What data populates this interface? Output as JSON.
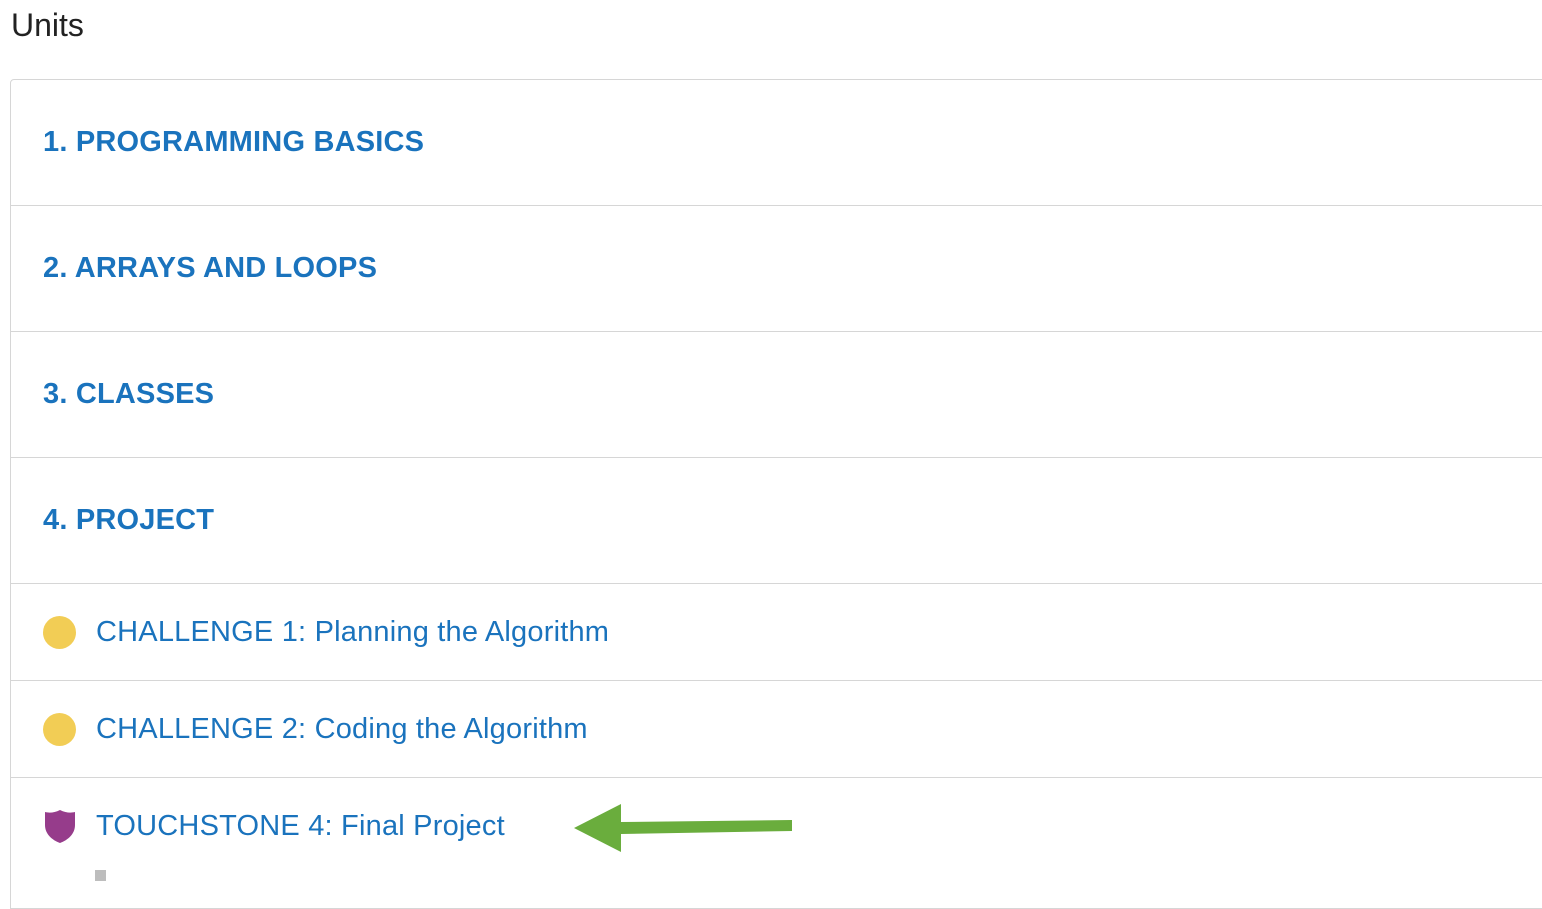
{
  "page": {
    "title": "Units"
  },
  "units": [
    {
      "label": "1. PROGRAMMING BASICS"
    },
    {
      "label": "2. ARRAYS AND LOOPS"
    },
    {
      "label": "3. CLASSES"
    },
    {
      "label": "4. PROJECT"
    }
  ],
  "activities": [
    {
      "label": "CHALLENGE 1: Planning the Algorithm",
      "icon": "circle-icon",
      "status_color": "#f2cd55"
    },
    {
      "label": "CHALLENGE 2: Coding the Algorithm",
      "icon": "circle-icon",
      "status_color": "#f2cd55"
    },
    {
      "label": "TOUCHSTONE 4: Final Project",
      "icon": "shield-icon",
      "status_color": "#963c8b"
    }
  ],
  "colors": {
    "link": "#1a73bd",
    "border": "#d6d6d6",
    "arrow": "#6aad3d"
  },
  "annotation": {
    "icon": "arrow-left-icon"
  }
}
